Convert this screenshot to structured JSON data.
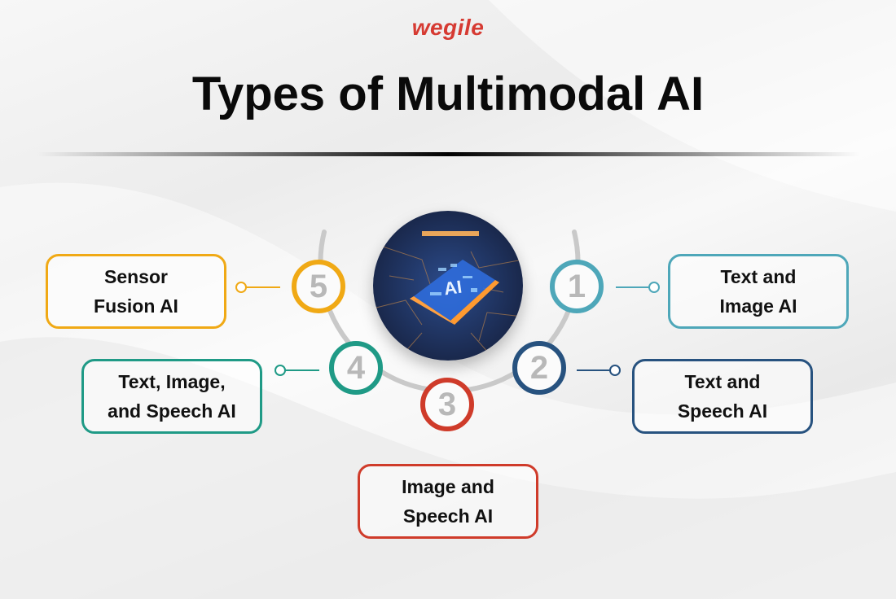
{
  "brand": {
    "logo_text": "wegile",
    "logo_color": "#d63a32"
  },
  "header": {
    "title": "Types of Multimodal AI"
  },
  "hub": {
    "label": "AI",
    "icon": "ai-chip-icon"
  },
  "colors": {
    "item1": "#4ea7b9",
    "item2": "#27527f",
    "item3": "#cf3b2a",
    "item4": "#1f9a86",
    "item5": "#f0a915",
    "arc": "#c9c9c9"
  },
  "items": [
    {
      "number": "1",
      "line1": "Text and",
      "line2": "Image AI"
    },
    {
      "number": "2",
      "line1": "Text and",
      "line2": "Speech AI"
    },
    {
      "number": "3",
      "line1": "Image and",
      "line2": "Speech AI"
    },
    {
      "number": "4",
      "line1": "Text, Image,",
      "line2": "and Speech AI"
    },
    {
      "number": "5",
      "line1": "Sensor",
      "line2": "Fusion AI"
    }
  ]
}
